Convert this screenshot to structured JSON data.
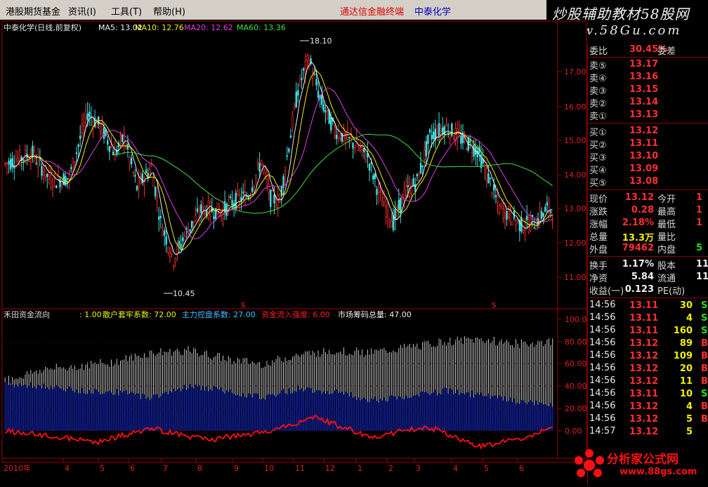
{
  "menu": {
    "items": [
      "港股期货基金",
      "资讯(I)",
      "工具(T)",
      "帮助(H)"
    ],
    "broker_label": "通达信金融终端",
    "stock_label": "中泰化学"
  },
  "banner": {
    "line1": "炒股辅助教材58股网",
    "line2": "www.58Gu.com"
  },
  "kchart": {
    "header_name": "中泰化学(日线,前复权)",
    "ma_labels": [
      {
        "text": "MA5: 13.02",
        "color": "#f0f0f0"
      },
      {
        "text": "MA10: 12.76",
        "color": "#f0f000"
      },
      {
        "text": "MA20: 12.62",
        "color": "#e040e0"
      },
      {
        "text": "MA60: 13.36",
        "color": "#40e040"
      }
    ],
    "price_axis": [
      "17.00",
      "16.00",
      "15.00",
      "14.00",
      "13.00",
      "12.00",
      "11.00"
    ],
    "high_label": "18.10",
    "low_label": "10.45",
    "marker": "S"
  },
  "indicator": {
    "name": "禾田资金流向",
    "params": [
      {
        "text": ": 1.00",
        "color": "#f0f000"
      },
      {
        "text": "散户套牢系数: 72.00",
        "color": "#f0f000"
      },
      {
        "text": "主力控盘系数: 27.00",
        "color": "#40c0ff"
      },
      {
        "text": "资金流入强度: 6.00",
        "color": "#ff2020"
      },
      {
        "text": "市场筹码总量: 47.00",
        "color": "#f0f0f0"
      }
    ],
    "axis": [
      "100.00",
      "80.00",
      "60.00",
      "40.00",
      "20.00",
      "0.00"
    ]
  },
  "time_axis": [
    "2010年",
    "4",
    "5",
    "6",
    "7",
    "8",
    "9",
    "10",
    "11",
    "12",
    "1",
    "2",
    "3",
    "4",
    "5",
    "6"
  ],
  "quote": {
    "weibi": {
      "label": "委比",
      "value": "30.45%",
      "label2": "委差"
    },
    "sell": [
      {
        "label": "卖⑤",
        "price": "13.17"
      },
      {
        "label": "卖④",
        "price": "13.16"
      },
      {
        "label": "卖③",
        "price": "13.15"
      },
      {
        "label": "卖②",
        "price": "13.14"
      },
      {
        "label": "卖①",
        "price": "13.13"
      }
    ],
    "buy": [
      {
        "label": "买①",
        "price": "13.12"
      },
      {
        "label": "买②",
        "price": "13.11"
      },
      {
        "label": "买③",
        "price": "13.10"
      },
      {
        "label": "买④",
        "price": "13.09"
      },
      {
        "label": "买⑤",
        "price": "13.08"
      }
    ],
    "stats": [
      {
        "l1": "现价",
        "v1": "13.12",
        "c1": "#ff3030",
        "l2": "今开",
        "v2": "1",
        "c2": "#ff3030"
      },
      {
        "l1": "涨跌",
        "v1": "0.28",
        "c1": "#ff3030",
        "l2": "最高",
        "v2": "1",
        "c2": "#ff3030"
      },
      {
        "l1": "涨幅",
        "v1": "2.18%",
        "c1": "#ff3030",
        "l2": "最低",
        "v2": "1",
        "c2": "#ff3030"
      },
      {
        "l1": "总量",
        "v1": "13.3万",
        "c1": "#f0f000",
        "l2": "量比",
        "v2": "",
        "c2": "#f0f000"
      },
      {
        "l1": "外盘",
        "v1": "79462",
        "c1": "#ff3030",
        "l2": "内盘",
        "v2": "5",
        "c2": "#20e020"
      }
    ],
    "stats2": [
      {
        "l1": "换手",
        "v1": "1.17%",
        "c1": "#f0f0f0",
        "l2": "股本",
        "v2": "11",
        "c2": "#f0f0f0"
      },
      {
        "l1": "净资",
        "v1": "5.84",
        "c1": "#f0f0f0",
        "l2": "流通",
        "v2": "11",
        "c2": "#f0f0f0"
      },
      {
        "l1": "收益(一)",
        "v1": "0.123",
        "c1": "#f0f0f0",
        "l2": "PE(动)",
        "v2": "",
        "c2": "#f0f0f0"
      }
    ],
    "ticks": [
      {
        "time": "14:56",
        "price": "13.11",
        "vol": "30",
        "dir": "S",
        "dcolor": "#20e020"
      },
      {
        "time": "14:56",
        "price": "13.11",
        "vol": "4",
        "dir": "S",
        "dcolor": "#20e020"
      },
      {
        "time": "14:56",
        "price": "13.11",
        "vol": "160",
        "dir": "S",
        "dcolor": "#20e020"
      },
      {
        "time": "14:56",
        "price": "13.12",
        "vol": "89",
        "dir": "B",
        "dcolor": "#ff3030"
      },
      {
        "time": "14:56",
        "price": "13.12",
        "vol": "109",
        "dir": "B",
        "dcolor": "#ff3030"
      },
      {
        "time": "14:56",
        "price": "13.12",
        "vol": "20",
        "dir": "B",
        "dcolor": "#ff3030"
      },
      {
        "time": "14:56",
        "price": "13.12",
        "vol": "11",
        "dir": "B",
        "dcolor": "#ff3030"
      },
      {
        "time": "14:56",
        "price": "13.11",
        "vol": "10",
        "dir": "S",
        "dcolor": "#20e020"
      },
      {
        "time": "14:56",
        "price": "13.12",
        "vol": "4",
        "dir": "B",
        "dcolor": "#ff3030"
      },
      {
        "time": "14:56",
        "price": "13.12",
        "vol": "5",
        "dir": "B",
        "dcolor": "#ff3030"
      },
      {
        "time": "14:57",
        "price": "13.12",
        "vol": "5",
        "dir": "",
        "dcolor": "#ff3030"
      }
    ]
  },
  "watermark": {
    "title": "分析家公式网",
    "url": "www.88gs.com"
  }
}
